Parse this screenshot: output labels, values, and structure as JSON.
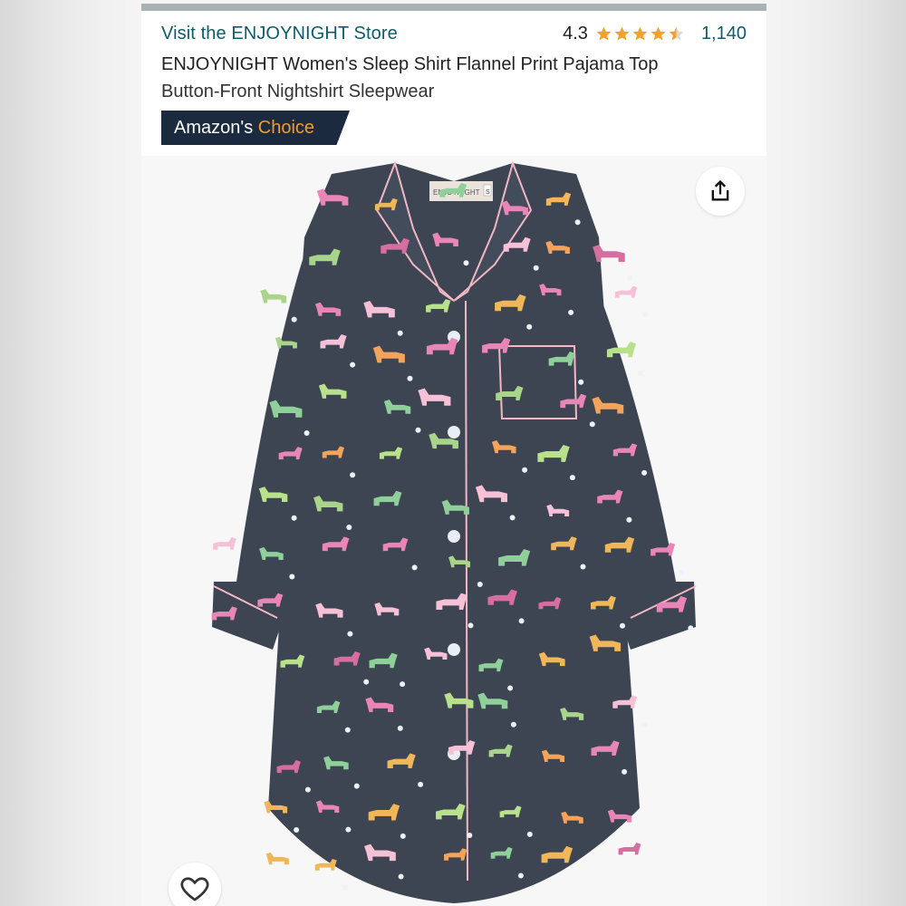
{
  "header": {
    "store_link": "Visit the ENJOYNIGHT Store",
    "rating_value": "4.3",
    "rating_stars": 4.3,
    "review_count": "1,140",
    "title_line1": "ENJOYNIGHT Women's Sleep Shirt Flannel Print Pajama Top",
    "title_line2": "Button-Front Nightshirt Sleepwear",
    "badge_prefix": "Amazon's",
    "badge_highlight": "Choice"
  },
  "product_image": {
    "label_brand": "ENJOYNIGHT",
    "label_size": "S"
  },
  "icons": {
    "share": "share-icon",
    "wishlist": "heart-icon",
    "star": "star-icon"
  },
  "colors": {
    "link": "#0f5b6b",
    "star": "#f0a22a",
    "badge_bg": "#1b2a3e",
    "badge_accent": "#f39a2b",
    "shirt": "#3d4552",
    "piping": "#f2b7c4"
  }
}
